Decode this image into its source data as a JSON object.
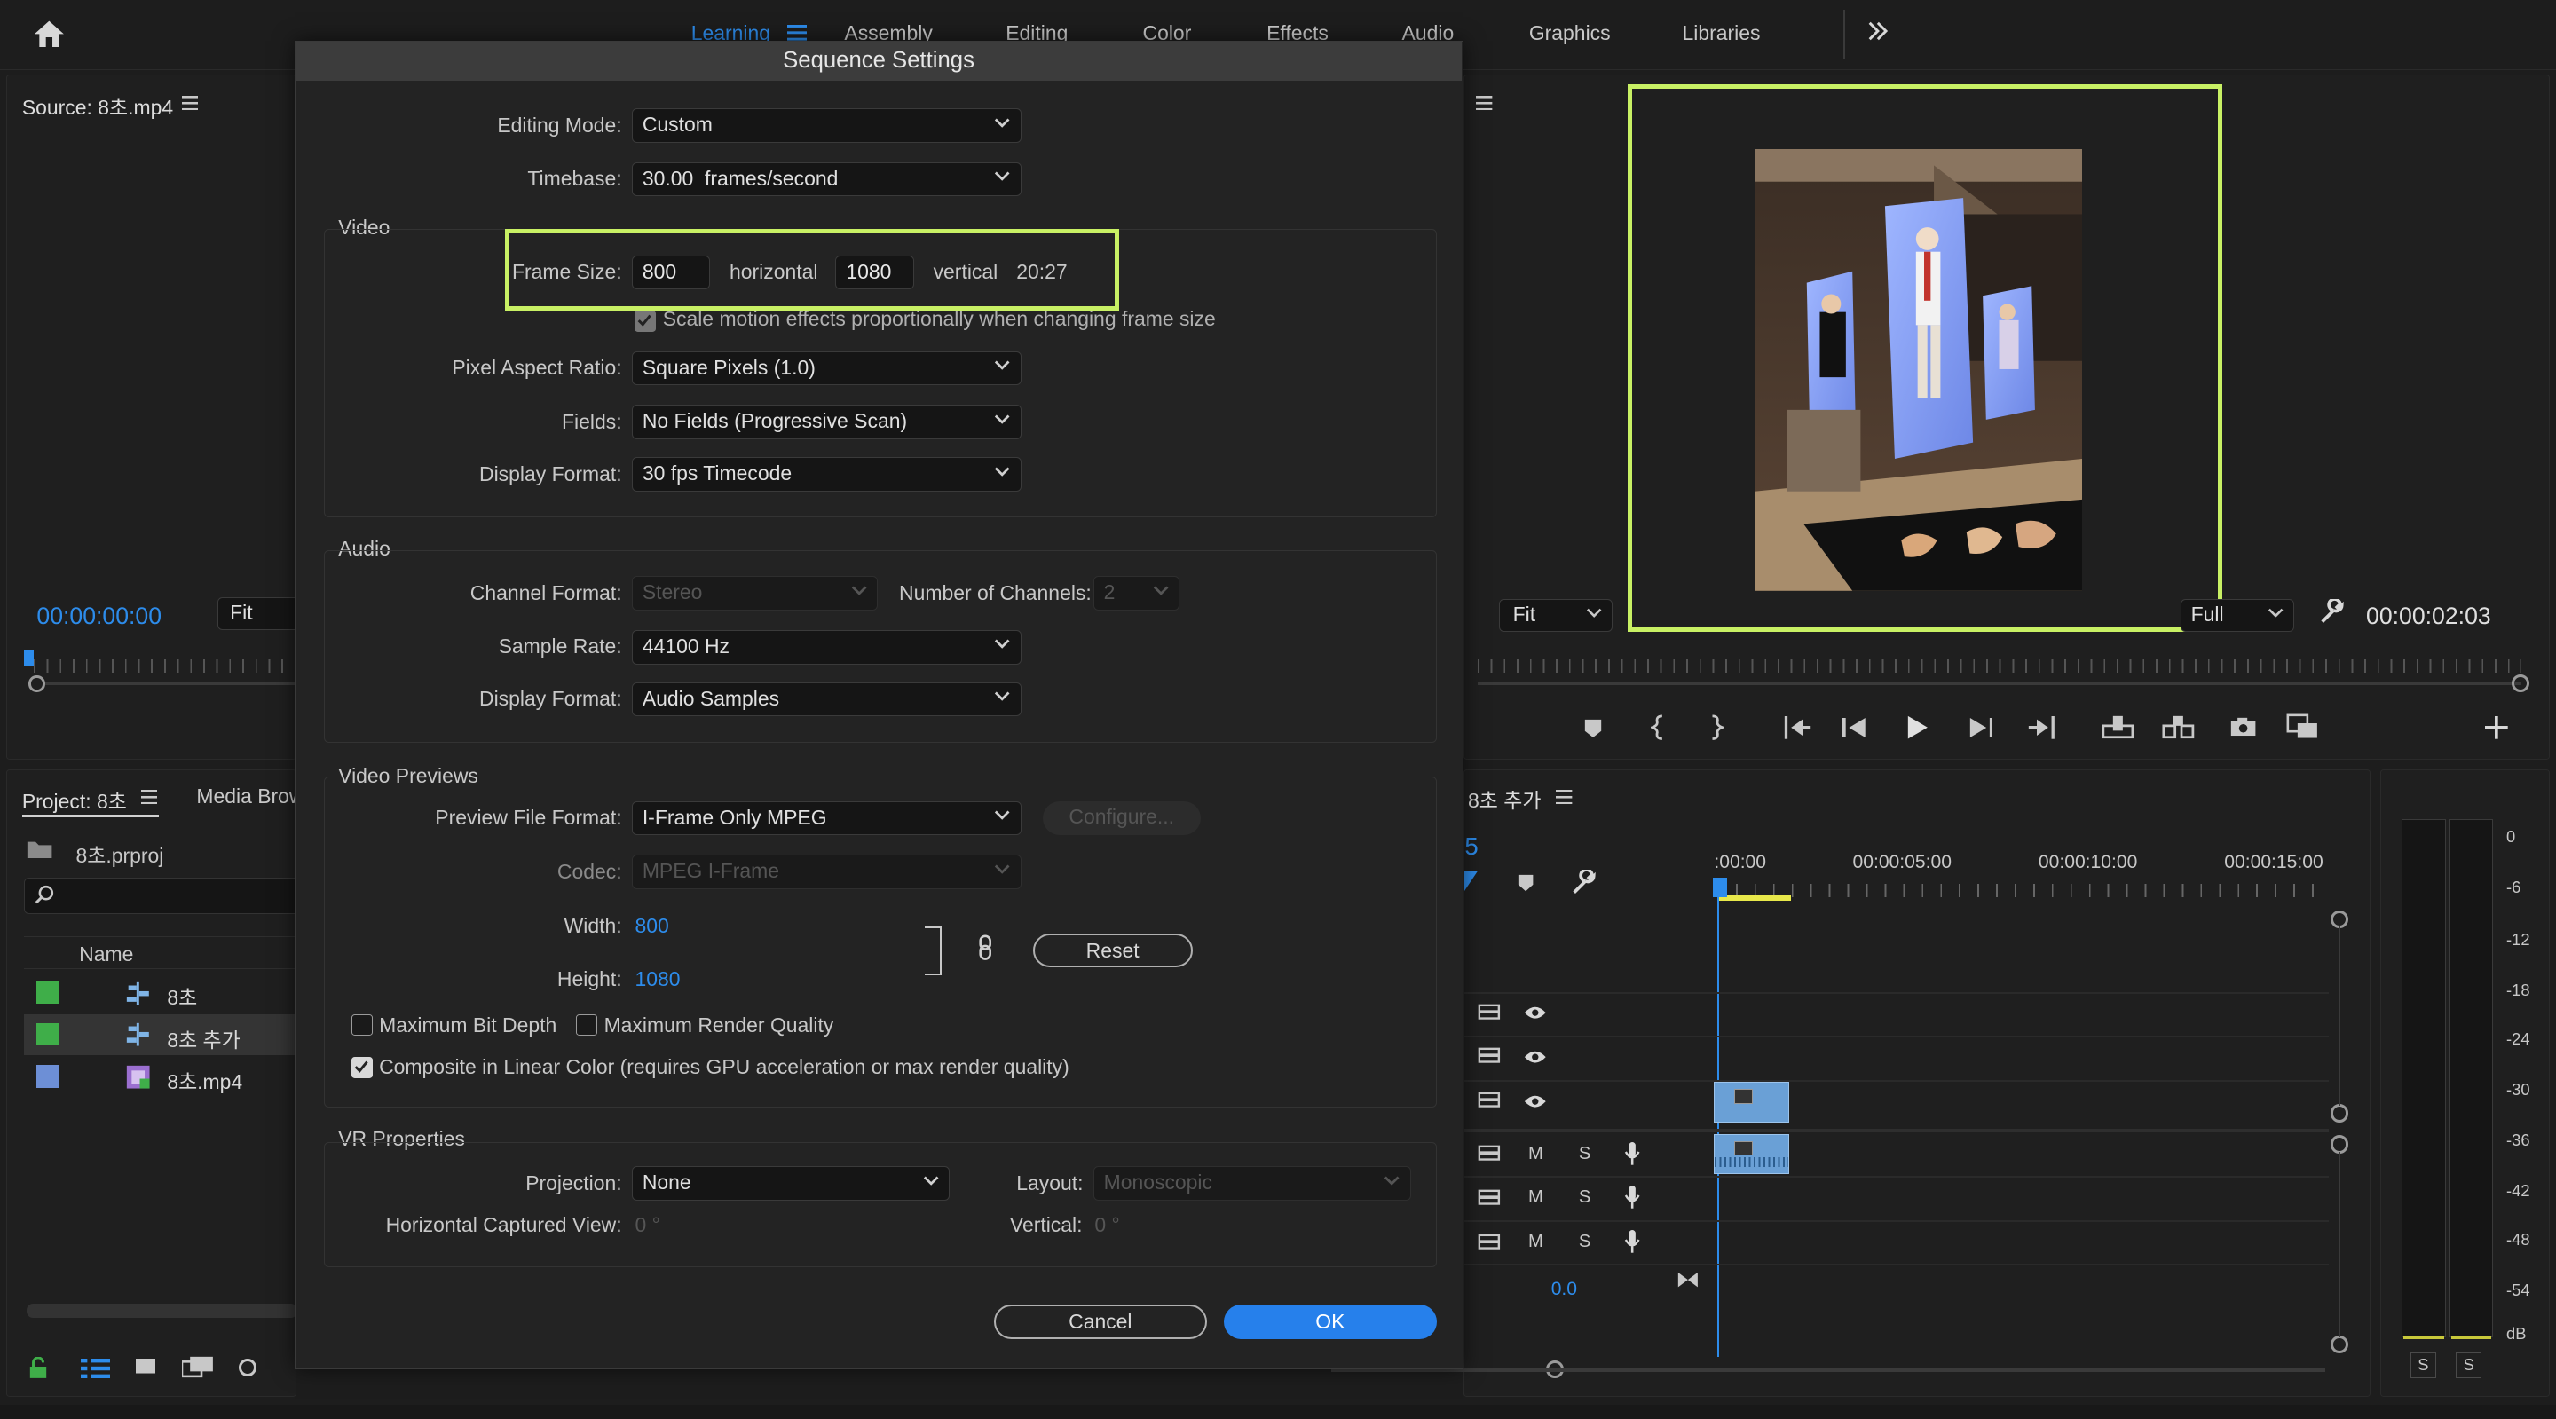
{
  "workspaces": {
    "tabs": [
      "Learning",
      "Assembly",
      "Editing",
      "Color",
      "Effects",
      "Audio",
      "Graphics",
      "Libraries"
    ],
    "active": "Learning"
  },
  "source_monitor": {
    "title": "Source: 8초.mp4",
    "timecode": "00:00:00:00",
    "zoom": "Fit"
  },
  "program_monitor": {
    "zoom": "Fit",
    "resolution": "Full",
    "timecode": "00:00:02:03"
  },
  "project": {
    "title": "Project: 8초",
    "media_tab": "Media Brow",
    "file": "8초.prproj",
    "column_name": "Name",
    "items": [
      {
        "name": "8초",
        "label_color": "#3fae49",
        "type": "sequence"
      },
      {
        "name": "8초 추가",
        "label_color": "#3fae49",
        "type": "sequence"
      },
      {
        "name": "8초.mp4",
        "label_color": "#6d8fd6",
        "type": "video"
      }
    ]
  },
  "timeline": {
    "title": "8초 추가",
    "playhead_digit": "5",
    "ruler": [
      ":00:00",
      "00:00:05:00",
      "00:00:10:00",
      "00:00:15:00"
    ],
    "audio_value": "0.0",
    "track_letters": {
      "m": "M",
      "s": "S"
    }
  },
  "meter": {
    "scale": [
      "0",
      "-6",
      "-12",
      "-18",
      "-24",
      "-30",
      "-36",
      "-42",
      "-48",
      "-54",
      "dB"
    ],
    "solo": [
      "S",
      "S"
    ]
  },
  "dialog": {
    "title": "Sequence Settings",
    "editing_mode_label": "Editing Mode:",
    "editing_mode": "Custom",
    "timebase_label": "Timebase:",
    "timebase": "30.00  frames/second",
    "video_group": "Video",
    "frame_size_label": "Frame Size:",
    "frame_width": "800",
    "horizontal": "horizontal",
    "frame_height": "1080",
    "vertical": "vertical",
    "aspect": "20:27",
    "scale_motion": "Scale motion effects proportionally when changing frame size",
    "par_label": "Pixel Aspect Ratio:",
    "par": "Square Pixels (1.0)",
    "fields_label": "Fields:",
    "fields": "No Fields (Progressive Scan)",
    "vdisplay_label": "Display Format:",
    "vdisplay": "30 fps Timecode",
    "audio_group": "Audio",
    "channel_format_label": "Channel Format:",
    "channel_format": "Stereo",
    "num_channels_label": "Number of Channels:",
    "num_channels": "2",
    "sample_rate_label": "Sample Rate:",
    "sample_rate": "44100 Hz",
    "adisplay_label": "Display Format:",
    "adisplay": "Audio Samples",
    "previews_group": "Video Previews",
    "preview_format_label": "Preview File Format:",
    "preview_format": "I-Frame Only MPEG",
    "configure": "Configure...",
    "codec_label": "Codec:",
    "codec": "MPEG I-Frame",
    "width_label": "Width:",
    "width": "800",
    "height_label": "Height:",
    "height": "1080",
    "reset": "Reset",
    "max_bit_depth": "Maximum Bit Depth",
    "max_render_quality": "Maximum Render Quality",
    "composite_linear": "Composite in Linear Color (requires GPU acceleration or max render quality)",
    "vr_group": "VR Properties",
    "projection_label": "Projection:",
    "projection": "None",
    "layout_label": "Layout:",
    "layout": "Monoscopic",
    "hcv_label": "Horizontal Captured View:",
    "hcv": "0 °",
    "vertical_label": "Vertical:",
    "vertical_val": "0 °",
    "cancel": "Cancel",
    "ok": "OK"
  },
  "colors": {
    "accent": "#2d8ceb",
    "highlight": "#c8f064",
    "ok_button": "#2680eb"
  }
}
